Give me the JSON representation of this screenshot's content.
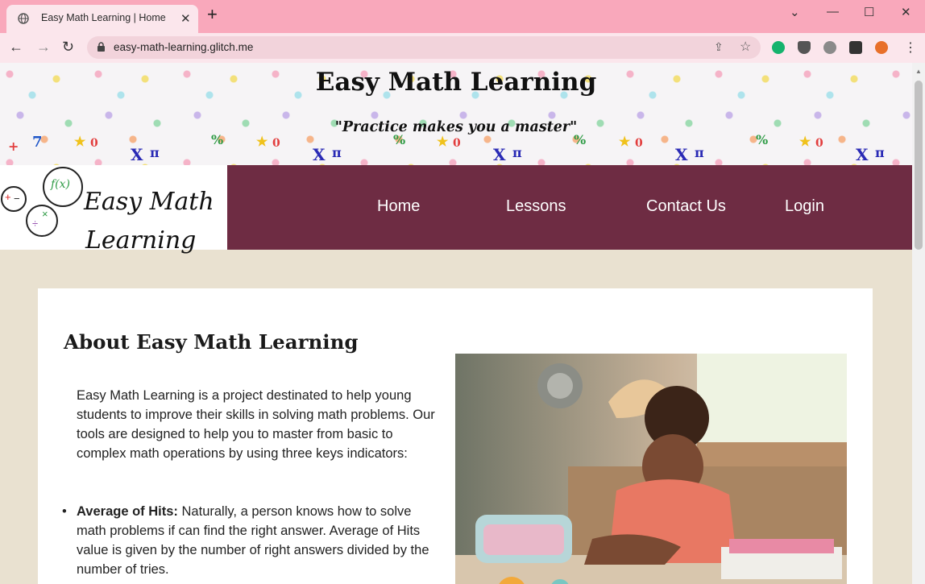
{
  "browser": {
    "tab_title": "Easy Math Learning | Home",
    "url": "easy-math-learning.glitch.me"
  },
  "site": {
    "title": "Easy Math Learning",
    "tagline": "\"Practice makes you a master\"",
    "logo": {
      "line1": "Easy Math",
      "line2": "Learning",
      "circle_text": "f(x)"
    },
    "nav": [
      "Home",
      "Lessons",
      "Contact Us",
      "Login"
    ]
  },
  "about": {
    "heading": "About Easy Math Learning",
    "intro": "Easy Math Learning is a project destinated to help young students to improve their skills in solving math problems. Our tools are designed to help you to master from basic to complex math operations by using three keys indicators:",
    "bullets": [
      {
        "term": "Average of Hits:",
        "text": "Naturally, a person knows how to solve math problems if can find the right answer. Average of Hits value is given by the number of right answers divided by the number of tries."
      }
    ]
  },
  "theme": {
    "tab_bar": "#f9a8bb",
    "nav_bg": "#6e2c43",
    "page_bg": "#e9e1d0"
  }
}
